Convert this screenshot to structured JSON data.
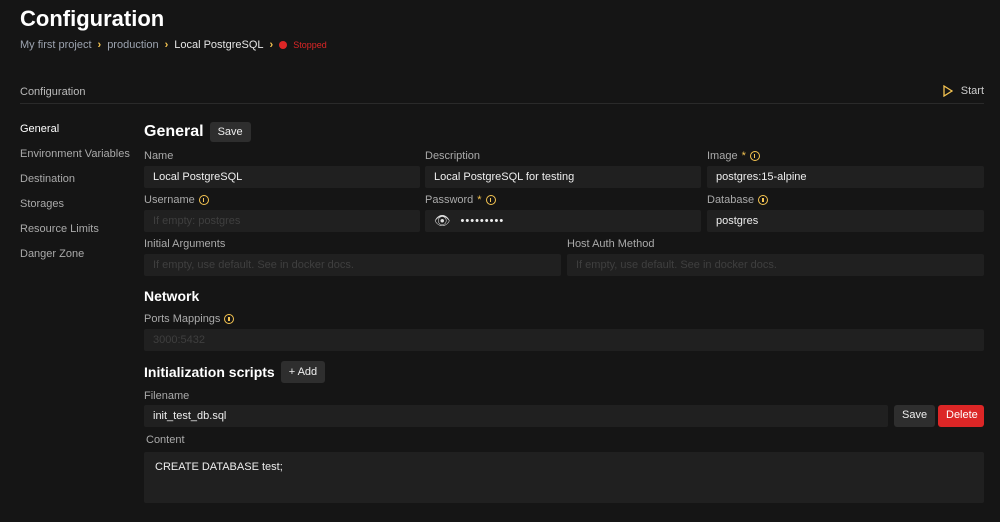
{
  "title": "Configuration",
  "breadcrumbs": [
    "My first project",
    "production",
    "Local PostgreSQL"
  ],
  "status": "Stopped",
  "tab": "Configuration",
  "start_label": "Start",
  "nav": [
    "General",
    "Environment Variables",
    "Destination",
    "Storages",
    "Resource Limits",
    "Danger Zone"
  ],
  "general": {
    "title": "General",
    "save": "Save",
    "name_label": "Name",
    "name": "Local PostgreSQL",
    "desc_label": "Description",
    "desc": "Local PostgreSQL for testing",
    "image_label": "Image",
    "image": "postgres:15-alpine",
    "user_label": "Username",
    "user_ph": "If empty: postgres",
    "pass_label": "Password",
    "pass": "•••••••••",
    "db_label": "Database",
    "db": "postgres",
    "args_label": "Initial Arguments",
    "args_ph": "If empty, use default. See in docker docs.",
    "auth_label": "Host Auth Method",
    "auth_ph": "If empty, use default. See in docker docs.",
    "req": "*"
  },
  "network": {
    "title": "Network",
    "ports_label": "Ports Mappings",
    "ports_ph": "3000:5432"
  },
  "init": {
    "title": "Initialization scripts",
    "add": "+ Add",
    "file_label": "Filename",
    "file": "init_test_db.sql",
    "save": "Save",
    "delete": "Delete",
    "content_label": "Content",
    "content": "CREATE DATABASE test;"
  }
}
